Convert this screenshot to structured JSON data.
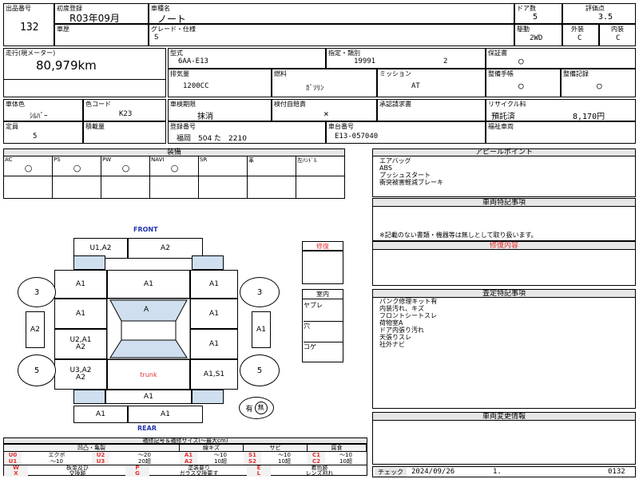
{
  "lot_no": {
    "label": "出品番号",
    "value": "132"
  },
  "first_reg": {
    "label": "初度登録",
    "value": "R03年09月"
  },
  "car_name": {
    "label": "車種名",
    "value": "ノート"
  },
  "doors": {
    "label": "ドア数",
    "value": "5"
  },
  "score": {
    "label": "評価点",
    "value": "3.5"
  },
  "history": {
    "label": "車歴"
  },
  "grade": {
    "label": "グレード・仕様",
    "value": "S"
  },
  "drive": {
    "label": "駆動",
    "value": "2WD"
  },
  "exterior": {
    "label": "外装",
    "value": "C"
  },
  "interior": {
    "label": "内装",
    "value": "C"
  },
  "mileage": {
    "label": "走行(現メーター)",
    "value": "80,979km"
  },
  "model": {
    "label": "型式",
    "value": "6AA-E13"
  },
  "designation": {
    "label": "指定・類別",
    "value1": "19991",
    "value2": "2"
  },
  "warranty": {
    "label": "保証書",
    "value": "○"
  },
  "displacement": {
    "label": "排気量",
    "value": "1200CC"
  },
  "fuel": {
    "label": "燃料",
    "value": "ｶﾞｿﾘﾝ"
  },
  "mission": {
    "label": "ミッション",
    "value": "AT"
  },
  "manual": {
    "label": "整備手帳",
    "value": "○"
  },
  "maint_record": {
    "label": "整備記録",
    "value": "○"
  },
  "body_color": {
    "label": "車体色",
    "value": "ｼﾙﾊﾞｰ"
  },
  "color_code": {
    "label": "色コード",
    "value": "K23"
  },
  "inspection": {
    "label": "車検期限",
    "value": "抹消"
  },
  "self_inspection": {
    "label": "検付自賠責",
    "value": "×"
  },
  "approval": {
    "label": "承認請求書"
  },
  "recycle": {
    "label": "リサイクル料",
    "status": "預託済",
    "amount": "8,170円"
  },
  "capacity": {
    "label": "定員",
    "value": "5"
  },
  "load": {
    "label": "積載量"
  },
  "reg_no": {
    "label": "登録番号",
    "value": "福岡　504 た　2210"
  },
  "chassis_no": {
    "label": "車台番号",
    "value": "E13-057040"
  },
  "welfare": {
    "label": "福祉車両"
  },
  "equipment": {
    "title": "装備",
    "headers": [
      "AC",
      "PS",
      "PW",
      "NAVI",
      "SR",
      "革",
      "左ﾊﾝﾄﾞﾙ"
    ],
    "values": [
      "○",
      "○",
      "○",
      "○",
      "",
      "",
      ""
    ]
  },
  "appeal": {
    "title": "アピールポイント",
    "lines": [
      "エアバッグ",
      "ABS",
      "プッシュスタート",
      "衝突被害軽減ブレーキ"
    ]
  },
  "special": {
    "title": "車両特記事項",
    "text": "※記載のない書類・機器等は無しとして取り扱います。"
  },
  "repair_history": {
    "title": "修復内容"
  },
  "inspector": {
    "title": "査定特記事項",
    "lines": [
      "パンク修理キット有",
      "内装汚れ、キズ",
      "フロントシートスレ",
      "荷物室A",
      "ドア内張り汚れ",
      "天張りスレ",
      "社外ナビ"
    ]
  },
  "change_info": {
    "title": "車両変更情報"
  },
  "diagram": {
    "front": "FRONT",
    "rear": "REAR",
    "trunk": "trunk",
    "repair_label": "修復",
    "interior_title": "室内",
    "interior_items": [
      "ヤブレ",
      "穴",
      "コゲ"
    ],
    "spare_tire": "有",
    "spare_tire_icon": "無",
    "wheel_fl": "3",
    "wheel_fr": "3",
    "wheel_rl": "5",
    "wheel_rr": "5",
    "bumper_front_left": "U1,A2",
    "bumper_front_right": "A2",
    "fender_fl": "A1",
    "hood": "A1",
    "fender_fr": "A1",
    "door_fl": "A1",
    "windshield": "A",
    "door_fr": "A1",
    "door_rl": "U2,A1\nA2",
    "door_rr": "A1",
    "qtr_rl": "U3,A2\nA2",
    "qtr_rr": "A1,S1",
    "mirror_l": "A2",
    "mirror_r": "A1",
    "tail": "A1",
    "bumper_rear_left": "A1",
    "bumper_rear_right": "A1"
  },
  "legend": {
    "title": "補修記号＆補修サイズ(～最大cm)",
    "col_headers": [
      "凹凸・亀裂",
      "線キズ",
      "サビ",
      "腐食"
    ],
    "rows": [
      [
        {
          "c": "U0",
          "t": "エクボ"
        },
        {
          "c": "U2",
          "t": "～20"
        },
        {
          "c": "A1",
          "t": "～10"
        },
        {
          "c": "S1",
          "t": "～10"
        },
        {
          "c": "C1",
          "t": "～10"
        }
      ],
      [
        {
          "c": "U1",
          "t": "～10"
        },
        {
          "c": "U3",
          "t": "20超"
        },
        {
          "c": "A2",
          "t": "10超"
        },
        {
          "c": "S2",
          "t": "10超"
        },
        {
          "c": "C2",
          "t": "10超"
        }
      ]
    ],
    "rows2": [
      [
        {
          "c": "W",
          "t": "板金及び"
        },
        {
          "c": "P",
          "t": "塗装要り"
        },
        {
          "c": "E",
          "t": "着色跡"
        }
      ],
      [
        {
          "c": "X",
          "t": "交換跡"
        },
        {
          "c": "G",
          "t": "ガラス交換要す"
        },
        {
          "c": "L",
          "t": "レンズ割れ"
        }
      ]
    ]
  },
  "check": {
    "label": "チェック",
    "date": "2024/09/26",
    "num": "1.",
    "code": "0132"
  }
}
